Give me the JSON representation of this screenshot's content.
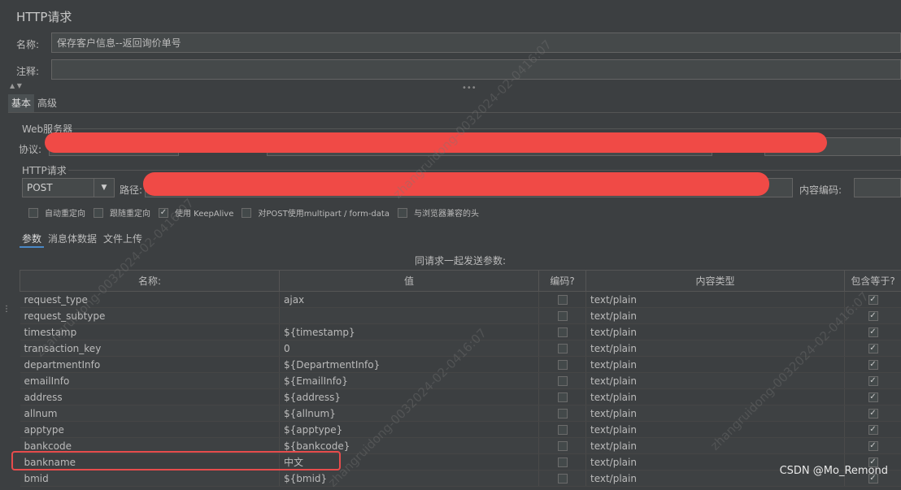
{
  "title": "HTTP请求",
  "name_label": "名称:",
  "name_value": "保存客户信息--返回询价单号",
  "comment_label": "注释:",
  "main_tabs": [
    "基本",
    "高级"
  ],
  "web_server": {
    "group_label": "Web服务器",
    "protocol_label": "协议:"
  },
  "http_request": {
    "group_label": "HTTP请求",
    "method": "POST",
    "path_label": "路径:",
    "encoding_label": "内容编码:"
  },
  "options": [
    {
      "label": "自动重定向",
      "checked": false
    },
    {
      "label": "跟随重定向",
      "checked": false
    },
    {
      "label": "使用 KeepAlive",
      "checked": true
    },
    {
      "label": "对POST使用multipart / form-data",
      "checked": false
    },
    {
      "label": "与浏览器兼容的头",
      "checked": false
    }
  ],
  "sub_tabs": [
    "参数",
    "消息体数据",
    "文件上传"
  ],
  "table": {
    "caption": "同请求一起发送参数:",
    "headers": [
      "名称:",
      "值",
      "编码?",
      "内容类型",
      "包含等于?"
    ],
    "rows": [
      {
        "name": "request_type",
        "value": "ajax",
        "encode": false,
        "type": "text/plain",
        "include_equals": true
      },
      {
        "name": "request_subtype",
        "value": "",
        "encode": false,
        "type": "text/plain",
        "include_equals": true
      },
      {
        "name": "timestamp",
        "value": "${timestamp}",
        "encode": false,
        "type": "text/plain",
        "include_equals": true
      },
      {
        "name": "transaction_key",
        "value": "0",
        "encode": false,
        "type": "text/plain",
        "include_equals": true
      },
      {
        "name": "departmentInfo",
        "value": "${DepartmentInfo}",
        "encode": false,
        "type": "text/plain",
        "include_equals": true
      },
      {
        "name": "emailInfo",
        "value": "${EmailInfo}",
        "encode": false,
        "type": "text/plain",
        "include_equals": true
      },
      {
        "name": "address",
        "value": "${address}",
        "encode": false,
        "type": "text/plain",
        "include_equals": true
      },
      {
        "name": "allnum",
        "value": "${allnum}",
        "encode": false,
        "type": "text/plain",
        "include_equals": true
      },
      {
        "name": "apptype",
        "value": "${apptype}",
        "encode": false,
        "type": "text/plain",
        "include_equals": true
      },
      {
        "name": "bankcode",
        "value": "${bankcode}",
        "encode": false,
        "type": "text/plain",
        "include_equals": true
      },
      {
        "name": "bankname",
        "value": "中文",
        "encode": false,
        "type": "text/plain",
        "include_equals": true
      },
      {
        "name": "bmid",
        "value": "${bmid}",
        "encode": false,
        "type": "text/plain",
        "include_equals": true
      }
    ]
  },
  "watermark_text": "zhangruidong-0032024-02-0416:07",
  "credit": "CSDN @Mo_Remond"
}
